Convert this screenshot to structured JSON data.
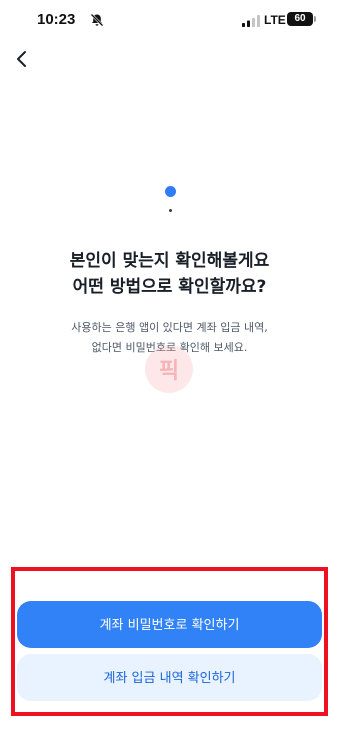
{
  "status_bar": {
    "time": "10:23",
    "network": "LTE",
    "battery": "60"
  },
  "icons": {
    "back": "chevron-left-icon",
    "bell": "bell-off-icon",
    "signal": "signal-bars-icon"
  },
  "main": {
    "title_line1": "본인이 맞는지 확인해볼게요",
    "title_line2": "어떤 방법으로 확인할까요?",
    "subtitle_line1": "사용하는 은행 앱이 있다면 계좌 입금 내역,",
    "subtitle_line2": "없다면 비밀번호로 확인해 보세요.",
    "watermark": "픽"
  },
  "actions": {
    "primary_label": "계좌 비밀번호로 확인하기",
    "secondary_label": "계좌 입금 내역 확인하기"
  },
  "colors": {
    "accent": "#3182f6",
    "secondary_bg": "#e8f3ff",
    "secondary_text": "#1b64da",
    "highlight": "#ee1122"
  }
}
